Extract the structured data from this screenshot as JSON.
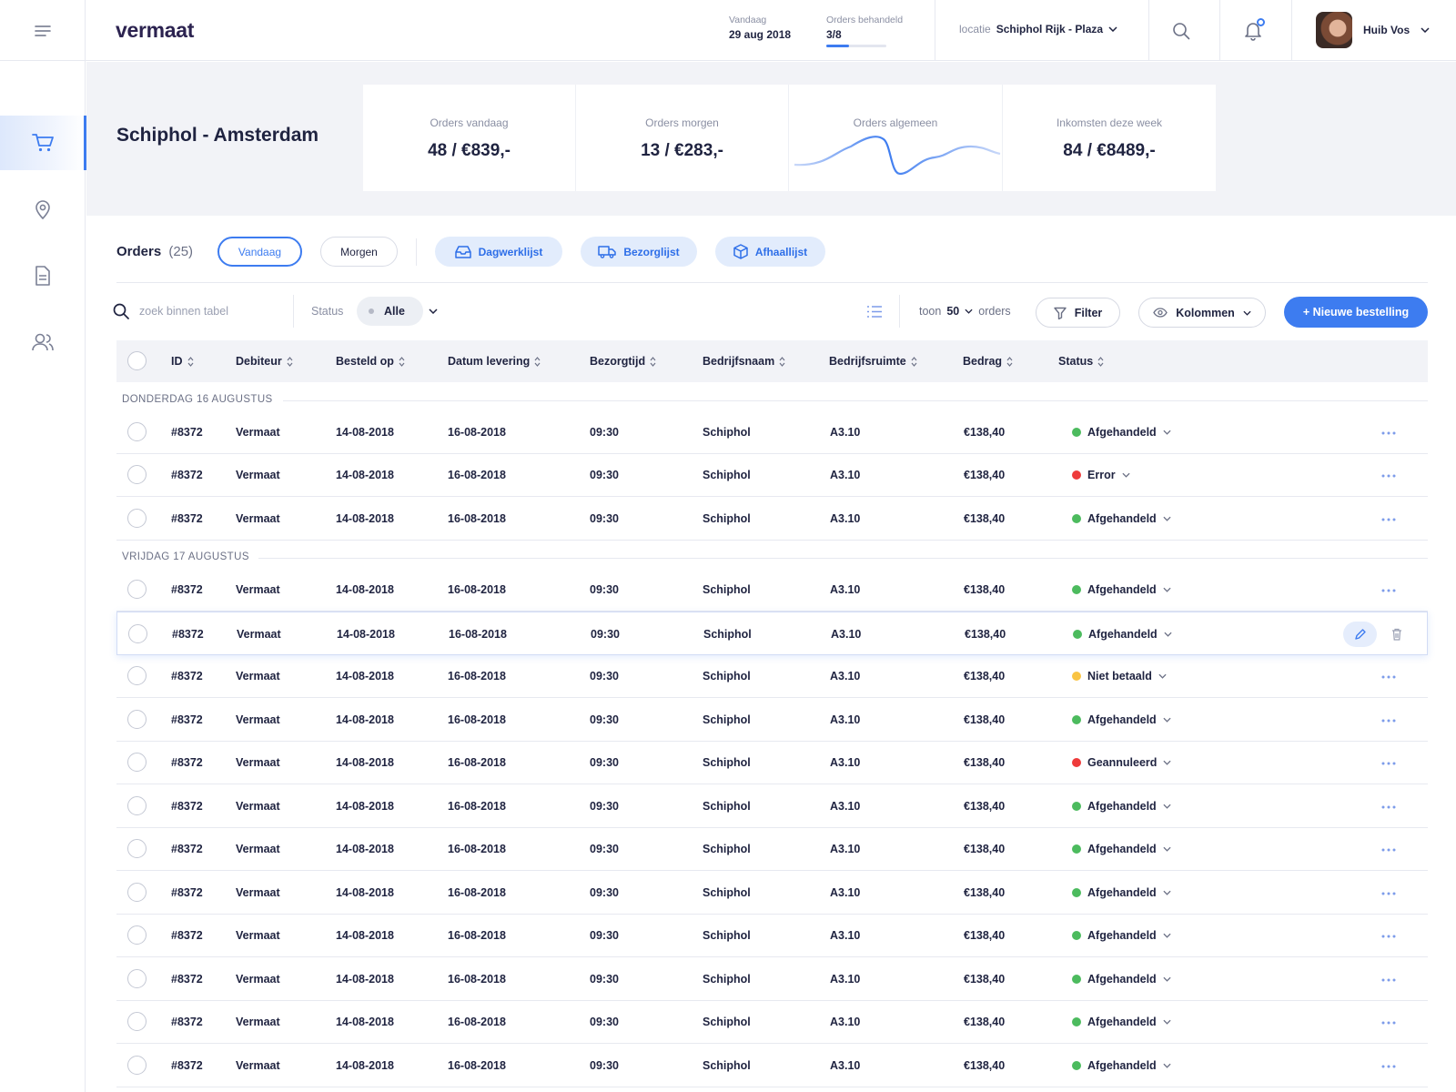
{
  "header": {
    "logo": "vermaat",
    "vandaag_label": "Vandaag",
    "vandaag_value": "29 aug 2018",
    "orders_label": "Orders behandeld",
    "orders_value": "3/8",
    "orders_progress": 0.375,
    "locatie_label": "locatie",
    "locatie_value": "Schiphol Rijk - Plaza",
    "user_name": "Huib Vos"
  },
  "sidebar": {
    "items": [
      {
        "icon": "cart-icon",
        "active": true
      },
      {
        "icon": "location-pin-icon",
        "active": false
      },
      {
        "icon": "document-icon",
        "active": false
      },
      {
        "icon": "users-icon",
        "active": false
      }
    ]
  },
  "summary": {
    "title": "Schiphol - Amsterdam",
    "cards": [
      {
        "label": "Orders vandaag",
        "value": "48 / €839,-"
      },
      {
        "label": "Orders morgen",
        "value": "13 / €283,-"
      },
      {
        "label": "Orders algemeen",
        "value": ""
      },
      {
        "label": "Inkomsten deze week",
        "value": "84 / €8489,-"
      }
    ]
  },
  "orders": {
    "title": "Orders",
    "count": "(25)",
    "tab_vandaag": "Vandaag",
    "tab_morgen": "Morgen",
    "btn_dagwerklijst": "Dagwerklijst",
    "btn_bezorglijst": "Bezorglijst",
    "btn_afhaallijst": "Afhaallijst"
  },
  "toolbar": {
    "search_placeholder": "zoek binnen tabel",
    "status_label": "Status",
    "status_value": "Alle",
    "toon_label": "toon",
    "toon_value": "50",
    "orders_suffix": "orders",
    "filter_label": "Filter",
    "kolommen_label": "Kolommen",
    "new_order_label": "+ Nieuwe bestelling"
  },
  "table": {
    "columns": [
      "ID",
      "Debiteur",
      "Besteld op",
      "Datum levering",
      "Bezorgtijd",
      "Bedrijfsnaam",
      "Bedrijfsruimte",
      "Bedrag",
      "Status"
    ],
    "groups": [
      "DONDERDAG 16 AUGUSTUS",
      "VRIJDAG 17 AUGUSTUS"
    ],
    "rows": [
      {
        "id": "#8372",
        "debiteur": "Vermaat",
        "besteld": "14-08-2018",
        "levering": "16-08-2018",
        "tijd": "09:30",
        "bedrijf": "Schiphol",
        "ruimte": "A3.10",
        "bedrag": "€138,40",
        "status": "Afgehandeld"
      },
      {
        "id": "#8372",
        "debiteur": "Vermaat",
        "besteld": "14-08-2018",
        "levering": "16-08-2018",
        "tijd": "09:30",
        "bedrijf": "Schiphol",
        "ruimte": "A3.10",
        "bedrag": "€138,40",
        "status": "Error"
      },
      {
        "id": "#8372",
        "debiteur": "Vermaat",
        "besteld": "14-08-2018",
        "levering": "16-08-2018",
        "tijd": "09:30",
        "bedrijf": "Schiphol",
        "ruimte": "A3.10",
        "bedrag": "€138,40",
        "status": "Afgehandeld"
      },
      {
        "id": "#8372",
        "debiteur": "Vermaat",
        "besteld": "14-08-2018",
        "levering": "16-08-2018",
        "tijd": "09:30",
        "bedrijf": "Schiphol",
        "ruimte": "A3.10",
        "bedrag": "€138,40",
        "status": "Afgehandeld"
      },
      {
        "id": "#8372",
        "debiteur": "Vermaat",
        "besteld": "14-08-2018",
        "levering": "16-08-2018",
        "tijd": "09:30",
        "bedrijf": "Schiphol",
        "ruimte": "A3.10",
        "bedrag": "€138,40",
        "status": "Afgehandeld"
      },
      {
        "id": "#8372",
        "debiteur": "Vermaat",
        "besteld": "14-08-2018",
        "levering": "16-08-2018",
        "tijd": "09:30",
        "bedrijf": "Schiphol",
        "ruimte": "A3.10",
        "bedrag": "€138,40",
        "status": "Niet betaald"
      },
      {
        "id": "#8372",
        "debiteur": "Vermaat",
        "besteld": "14-08-2018",
        "levering": "16-08-2018",
        "tijd": "09:30",
        "bedrijf": "Schiphol",
        "ruimte": "A3.10",
        "bedrag": "€138,40",
        "status": "Afgehandeld"
      },
      {
        "id": "#8372",
        "debiteur": "Vermaat",
        "besteld": "14-08-2018",
        "levering": "16-08-2018",
        "tijd": "09:30",
        "bedrijf": "Schiphol",
        "ruimte": "A3.10",
        "bedrag": "€138,40",
        "status": "Geannuleerd"
      },
      {
        "id": "#8372",
        "debiteur": "Vermaat",
        "besteld": "14-08-2018",
        "levering": "16-08-2018",
        "tijd": "09:30",
        "bedrijf": "Schiphol",
        "ruimte": "A3.10",
        "bedrag": "€138,40",
        "status": "Afgehandeld"
      },
      {
        "id": "#8372",
        "debiteur": "Vermaat",
        "besteld": "14-08-2018",
        "levering": "16-08-2018",
        "tijd": "09:30",
        "bedrijf": "Schiphol",
        "ruimte": "A3.10",
        "bedrag": "€138,40",
        "status": "Afgehandeld"
      },
      {
        "id": "#8372",
        "debiteur": "Vermaat",
        "besteld": "14-08-2018",
        "levering": "16-08-2018",
        "tijd": "09:30",
        "bedrijf": "Schiphol",
        "ruimte": "A3.10",
        "bedrag": "€138,40",
        "status": "Afgehandeld"
      },
      {
        "id": "#8372",
        "debiteur": "Vermaat",
        "besteld": "14-08-2018",
        "levering": "16-08-2018",
        "tijd": "09:30",
        "bedrijf": "Schiphol",
        "ruimte": "A3.10",
        "bedrag": "€138,40",
        "status": "Afgehandeld"
      },
      {
        "id": "#8372",
        "debiteur": "Vermaat",
        "besteld": "14-08-2018",
        "levering": "16-08-2018",
        "tijd": "09:30",
        "bedrijf": "Schiphol",
        "ruimte": "A3.10",
        "bedrag": "€138,40",
        "status": "Afgehandeld"
      },
      {
        "id": "#8372",
        "debiteur": "Vermaat",
        "besteld": "14-08-2018",
        "levering": "16-08-2018",
        "tijd": "09:30",
        "bedrijf": "Schiphol",
        "ruimte": "A3.10",
        "bedrag": "€138,40",
        "status": "Afgehandeld"
      },
      {
        "id": "#8372",
        "debiteur": "Vermaat",
        "besteld": "14-08-2018",
        "levering": "16-08-2018",
        "tijd": "09:30",
        "bedrijf": "Schiphol",
        "ruimte": "A3.10",
        "bedrag": "€138,40",
        "status": "Afgehandeld"
      }
    ],
    "highlighted_row": 4
  },
  "colors": {
    "accent": "#3d7cf0",
    "status_ok": "#4cbb5e",
    "status_error": "#ee3b3b",
    "status_warning": "#f9c443"
  }
}
